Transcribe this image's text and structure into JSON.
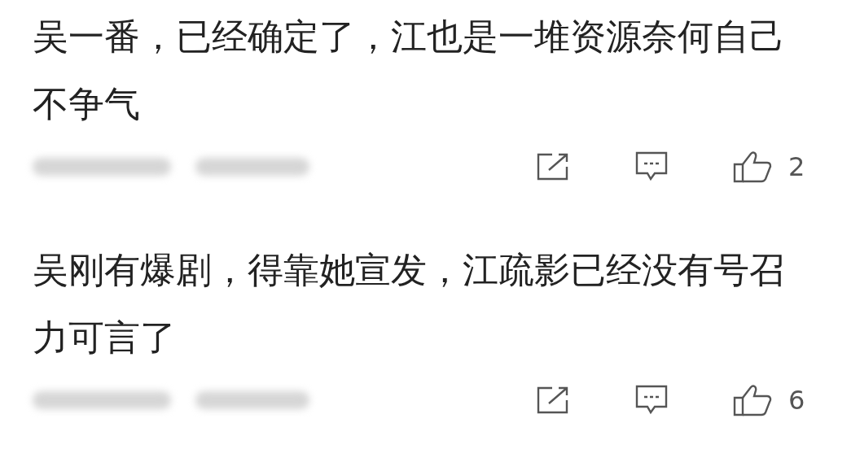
{
  "comments": [
    {
      "text": "吴一番，已经确定了，江也是一堆资源奈何自己不争气",
      "likes": "2"
    },
    {
      "text": "吴刚有爆剧，得靠她宣发，江疏影已经没有号召力可言了",
      "likes": "6"
    }
  ]
}
